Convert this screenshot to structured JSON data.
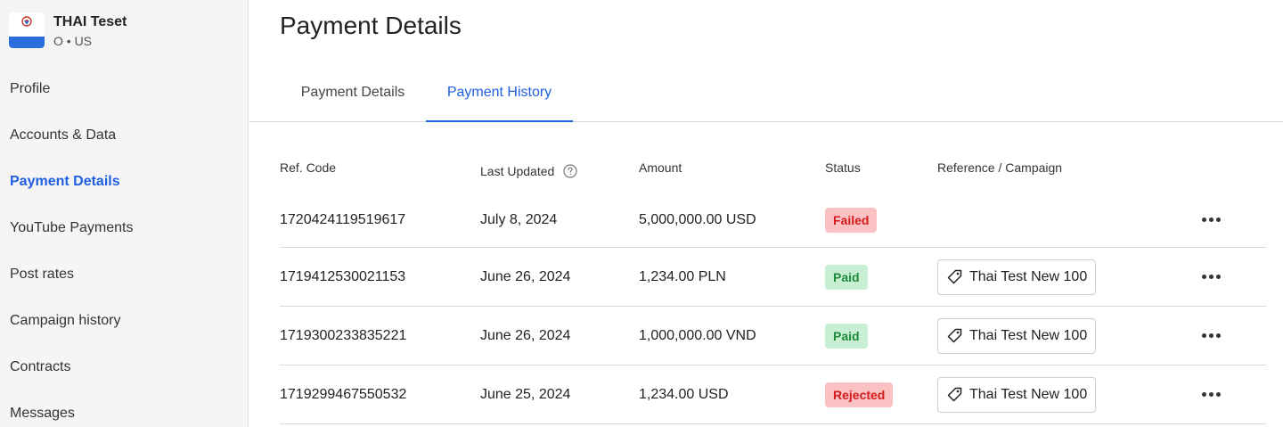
{
  "sidebar": {
    "profile": {
      "name": "THAI Teset",
      "subtitle": "O • US"
    },
    "items": [
      {
        "label": "Profile"
      },
      {
        "label": "Accounts & Data"
      },
      {
        "label": "Payment Details"
      },
      {
        "label": "YouTube Payments"
      },
      {
        "label": "Post rates"
      },
      {
        "label": "Campaign history"
      },
      {
        "label": "Contracts"
      },
      {
        "label": "Messages"
      }
    ]
  },
  "main": {
    "title": "Payment Details",
    "tabs": [
      {
        "label": "Payment Details"
      },
      {
        "label": "Payment History"
      }
    ],
    "table": {
      "headers": {
        "ref": "Ref. Code",
        "updated": "Last Updated",
        "amount": "Amount",
        "status": "Status",
        "campaign": "Reference / Campaign"
      },
      "rows": [
        {
          "ref": "1720424119519617",
          "date": "July 8, 2024",
          "amount": "5,000,000.00 USD",
          "status": "Failed",
          "campaign": ""
        },
        {
          "ref": "1719412530021153",
          "date": "June 26, 2024",
          "amount": "1,234.00 PLN",
          "status": "Paid",
          "campaign": "Thai Test New 100"
        },
        {
          "ref": "1719300233835221",
          "date": "June 26, 2024",
          "amount": "1,000,000.00 VND",
          "status": "Paid",
          "campaign": "Thai Test New 100"
        },
        {
          "ref": "1719299467550532",
          "date": "June 25, 2024",
          "amount": "1,234.00 USD",
          "status": "Rejected",
          "campaign": "Thai Test New 100"
        }
      ]
    }
  },
  "colors": {
    "accent": "#1f5fe0",
    "failed_bg": "#f9c1c1",
    "failed_text": "#d41b1b",
    "paid_bg": "#c8eed3",
    "paid_text": "#1d8a3a"
  },
  "icons": {
    "help": "help-circle-icon",
    "tag": "tag-icon",
    "more": "more-horizontal-icon"
  }
}
